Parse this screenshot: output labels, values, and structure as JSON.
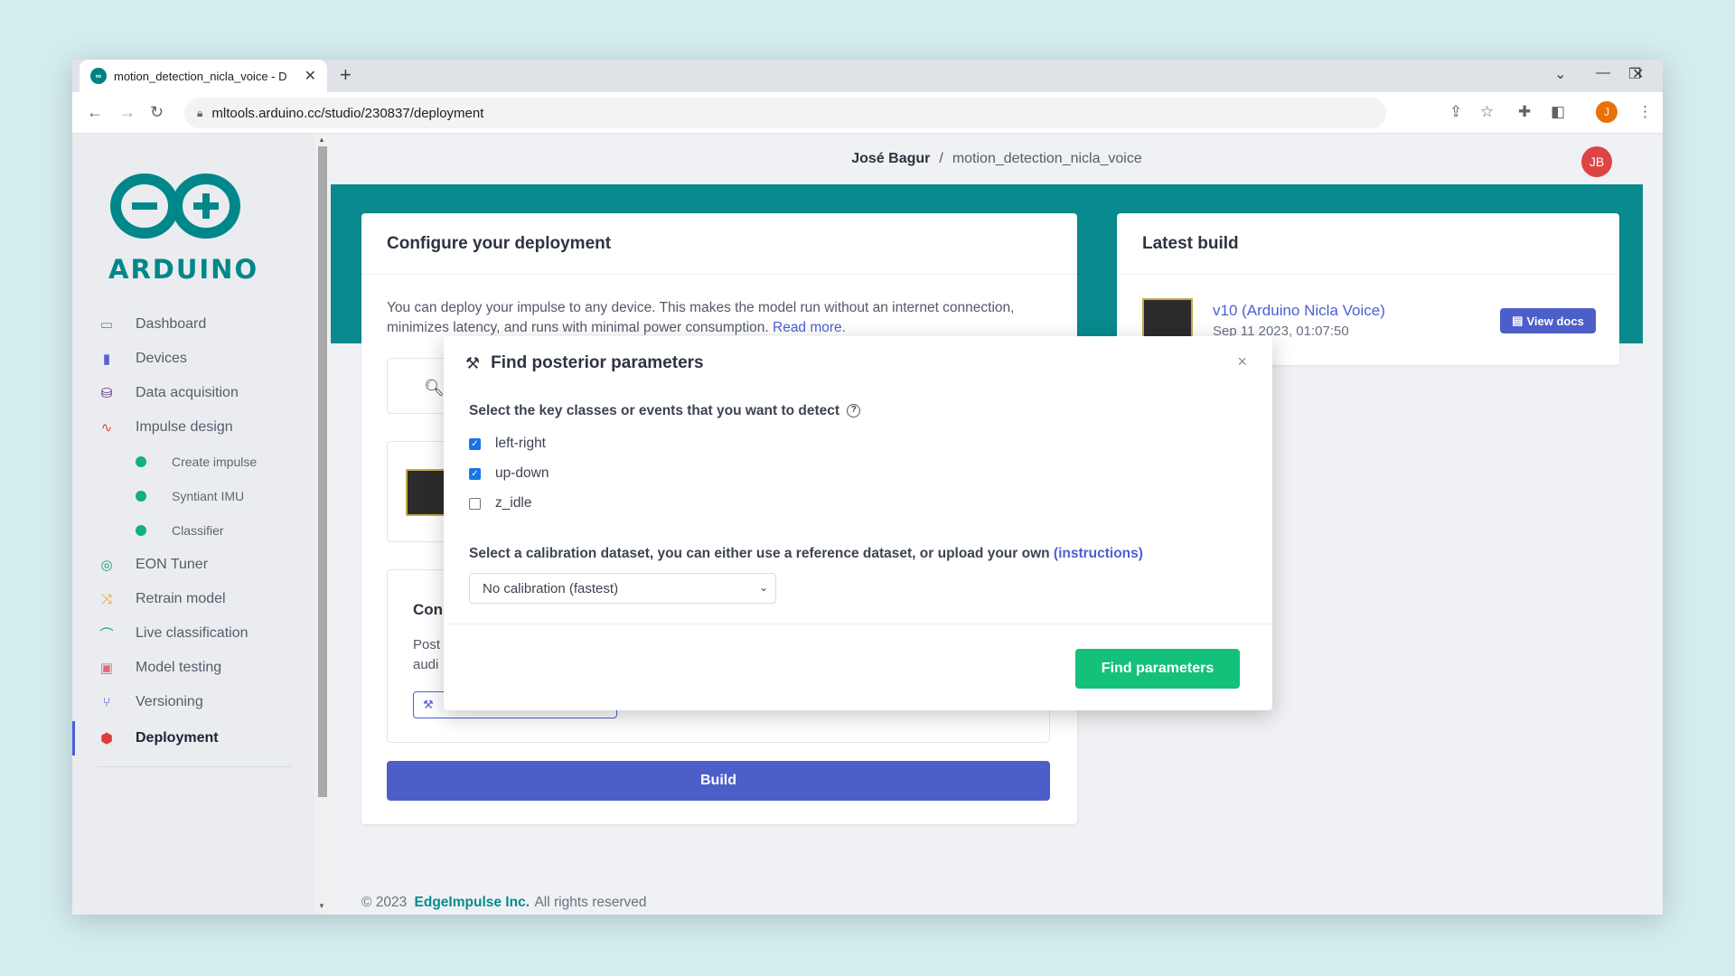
{
  "browser": {
    "tab_title": "motion_detection_nicla_voice - D",
    "url": "mltools.arduino.cc/studio/230837/deployment",
    "profile_initial": "J"
  },
  "logo": {
    "text": "ARDUINO"
  },
  "breadcrumb": {
    "owner": "José Bagur",
    "separator": "/",
    "project": "motion_detection_nicla_voice"
  },
  "user_avatar": "JB",
  "sidebar": {
    "items": [
      {
        "label": "Dashboard",
        "icon": "monitor-icon"
      },
      {
        "label": "Devices",
        "icon": "chip-icon"
      },
      {
        "label": "Data acquisition",
        "icon": "database-icon"
      },
      {
        "label": "Impulse design",
        "icon": "pulse-icon"
      },
      {
        "label": "Create impulse",
        "sub": true
      },
      {
        "label": "Syntiant IMU",
        "sub": true
      },
      {
        "label": "Classifier",
        "sub": true
      },
      {
        "label": "EON Tuner",
        "icon": "compass-icon"
      },
      {
        "label": "Retrain model",
        "icon": "shuffle-icon"
      },
      {
        "label": "Live classification",
        "icon": "signal-icon"
      },
      {
        "label": "Model testing",
        "icon": "clipboard-icon"
      },
      {
        "label": "Versioning",
        "icon": "branch-icon"
      },
      {
        "label": "Deployment",
        "icon": "box-icon",
        "active": true
      }
    ]
  },
  "configure": {
    "title": "Configure your deployment",
    "desc": "You can deploy your impulse to any device. This makes the model run without an internet connection, minimizes latency, and runs with minimal power consumption.",
    "read_more": "Read more.",
    "option_title": "Con",
    "option_text_1": "Post",
    "option_text_2": "audi",
    "build_label": "Build"
  },
  "latest_build": {
    "title": "Latest build",
    "version": "v10 (Arduino Nicla Voice)",
    "date": "Sep 11 2023, 01:07:50",
    "docs_label": "View docs"
  },
  "modal": {
    "title": "Find posterior parameters",
    "close": "×",
    "classes_question": "Select the key classes or events that you want to detect",
    "classes": [
      {
        "label": "left-right",
        "checked": true
      },
      {
        "label": "up-down",
        "checked": true
      },
      {
        "label": "z_idle",
        "checked": false
      }
    ],
    "calibration_question": "Select a calibration dataset, you can either use a reference dataset, or upload your own",
    "instructions_link": "(instructions)",
    "calibration_selected": "No calibration (fastest)",
    "submit_label": "Find parameters"
  },
  "footer": {
    "copyright": "© 2023",
    "company": "EdgeImpulse Inc.",
    "rights": "All rights reserved"
  },
  "colors": {
    "teal": "#088a8e",
    "primary": "#4c5fc9",
    "success": "#14c17a"
  }
}
